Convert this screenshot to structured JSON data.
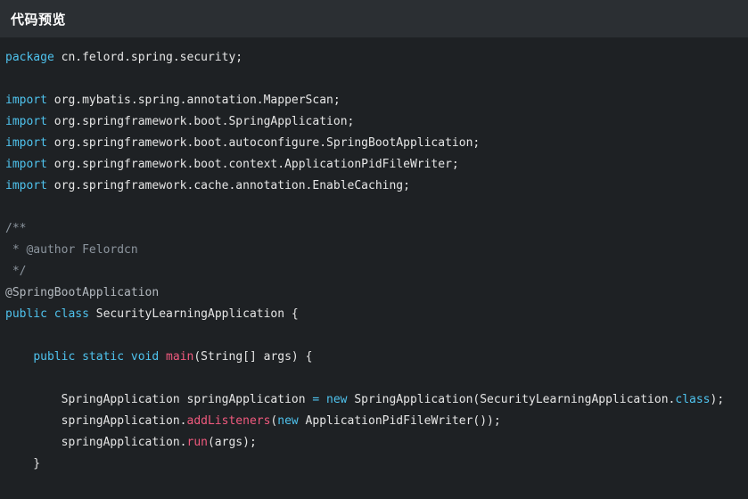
{
  "header": {
    "title": "代码预览"
  },
  "colors": {
    "background": "#1e2124",
    "header_background": "#2b2f33",
    "keyword": "#4fc3ee",
    "function": "#f05a7e",
    "comment": "#8c959e",
    "text": "#e6e6e6"
  },
  "code": {
    "lines": [
      [
        [
          "kw",
          "package"
        ],
        [
          "plain",
          " cn.felord.spring.security;"
        ]
      ],
      [],
      [
        [
          "kw",
          "import"
        ],
        [
          "plain",
          " org.mybatis.spring.annotation.MapperScan;"
        ]
      ],
      [
        [
          "kw",
          "import"
        ],
        [
          "plain",
          " org.springframework.boot.SpringApplication;"
        ]
      ],
      [
        [
          "kw",
          "import"
        ],
        [
          "plain",
          " org.springframework.boot.autoconfigure.SpringBootApplication;"
        ]
      ],
      [
        [
          "kw",
          "import"
        ],
        [
          "plain",
          " org.springframework.boot.context.ApplicationPidFileWriter;"
        ]
      ],
      [
        [
          "kw",
          "import"
        ],
        [
          "plain",
          " org.springframework.cache.annotation.EnableCaching;"
        ]
      ],
      [],
      [
        [
          "cm",
          "/**"
        ]
      ],
      [
        [
          "cm",
          " * @author Felordcn"
        ]
      ],
      [
        [
          "cm",
          " */"
        ]
      ],
      [
        [
          "ann",
          "@SpringBootApplication"
        ]
      ],
      [
        [
          "kw",
          "public"
        ],
        [
          "plain",
          " "
        ],
        [
          "kw",
          "class"
        ],
        [
          "plain",
          " SecurityLearningApplication {"
        ]
      ],
      [],
      [
        [
          "plain",
          "    "
        ],
        [
          "kw",
          "public"
        ],
        [
          "plain",
          " "
        ],
        [
          "kw",
          "static"
        ],
        [
          "plain",
          " "
        ],
        [
          "kw",
          "void"
        ],
        [
          "plain",
          " "
        ],
        [
          "fn",
          "main"
        ],
        [
          "plain",
          "(String[] args) {"
        ]
      ],
      [],
      [
        [
          "plain",
          "        SpringApplication springApplication "
        ],
        [
          "op",
          "="
        ],
        [
          "plain",
          " "
        ],
        [
          "kw",
          "new"
        ],
        [
          "plain",
          " SpringApplication(SecurityLearningApplication."
        ],
        [
          "kw",
          "class"
        ],
        [
          "plain",
          ");"
        ]
      ],
      [
        [
          "plain",
          "        springApplication."
        ],
        [
          "fn",
          "addListeners"
        ],
        [
          "plain",
          "("
        ],
        [
          "kw",
          "new"
        ],
        [
          "plain",
          " ApplicationPidFileWriter());"
        ]
      ],
      [
        [
          "plain",
          "        springApplication."
        ],
        [
          "fn",
          "run"
        ],
        [
          "plain",
          "(args);"
        ]
      ],
      [
        [
          "plain",
          "    }"
        ]
      ]
    ]
  }
}
